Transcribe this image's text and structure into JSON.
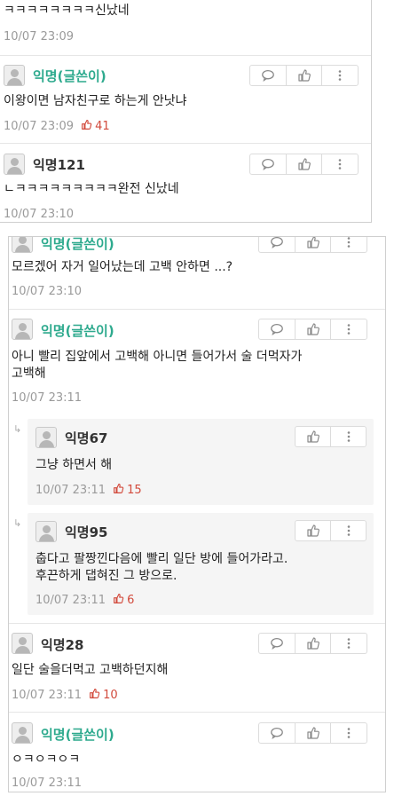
{
  "panel1": {
    "c0": {
      "text": "ㅋㅋㅋㅋㅋㅋㅋㅋ신났네",
      "time": "10/07 23:09"
    },
    "c1": {
      "nick": "익명(글쓴이)",
      "text": "이왕이면 남자친구로 하는게 안낫냐",
      "time": "10/07 23:09",
      "likes": "41"
    },
    "c2": {
      "nick": "익명121",
      "text": "ㄴㅋㅋㅋㅋㅋㅋㅋㅋㅋ완전 신났네",
      "time": "10/07 23:10"
    }
  },
  "panel2": {
    "c0": {
      "nick": "익명(글쓴이)",
      "text": "모르겠어 자거 일어났는데 고백 안하면 ...?",
      "time": "10/07 23:10"
    },
    "c1": {
      "nick": "익명(글쓴이)",
      "text1": "아니 빨리 집앞에서 고백해 아니면 들어가서 술 더먹자가",
      "text2": "고백해",
      "time": "10/07 23:11"
    },
    "r1": {
      "nick": "익명67",
      "text": "그냥 하면서 해",
      "time": "10/07 23:11",
      "likes": "15"
    },
    "r2": {
      "nick": "익명95",
      "text1": "춥다고 팔짱낀다음에 빨리 일단 방에 들어가라고.",
      "text2": "후끈하게 댑혀진 그 방으로.",
      "time": "10/07 23:11",
      "likes": "6"
    },
    "c2": {
      "nick": "익명28",
      "text": "일단 술을더먹고 고백하던지해",
      "time": "10/07 23:11",
      "likes": "10"
    },
    "c3": {
      "nick": "익명(글쓴이)",
      "text": "ㅇㅋㅇㅋㅇㅋ",
      "time": "10/07 23:11"
    }
  },
  "icons": {
    "reply": "speech-bubble-icon",
    "like": "thumbs-up-icon",
    "more": "more-vertical-icon",
    "reply_arrow": "reply-arrow-icon",
    "like_count": "thumbs-up-icon"
  },
  "colors": {
    "op_nick": "#2eaa8e",
    "likes": "#d24a3c",
    "meta": "#9a9a9a"
  }
}
